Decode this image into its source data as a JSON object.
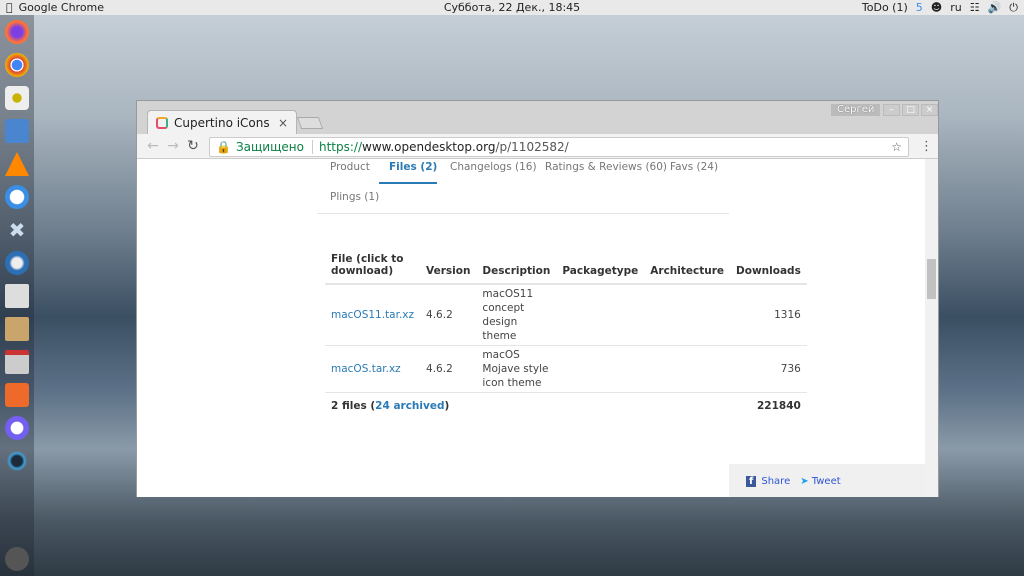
{
  "topbar": {
    "app": "Google Chrome",
    "datetime": "Суббота, 22 Дек., 18:45",
    "todo": "ToDo (1)",
    "badge": "5",
    "lang": "ru"
  },
  "dock": [
    "firefox",
    "chrome",
    "audio-player",
    "file-manager",
    "vlc",
    "simplenote",
    "system-tools",
    "thunderbird",
    "calculator",
    "package-installer",
    "archive-manager",
    "app-store",
    "viber",
    "deepin",
    "launcher"
  ],
  "browser": {
    "tab_title": "Cupertino iCons - w",
    "user": "Сергей",
    "secure_label": "Защищено",
    "url_scheme": "https://",
    "url_host": "www.opendesktop.org",
    "url_path": "/p/1102582/"
  },
  "page": {
    "tabs": [
      {
        "label": "Product"
      },
      {
        "label": "Files (2)",
        "active": true
      },
      {
        "label": "Changelogs (16)"
      },
      {
        "label": "Ratings & Reviews (60)"
      },
      {
        "label": "Favs (24)"
      },
      {
        "label": "Plings (1)"
      }
    ],
    "table": {
      "headers": [
        "File (click to download)",
        "Version",
        "Description",
        "Packagetype",
        "Architecture",
        "Downloads"
      ],
      "rows": [
        {
          "file": "macOS11.tar.xz",
          "version": "4.6.2",
          "description": "macOS11 concept design theme",
          "packagetype": "",
          "architecture": "",
          "downloads": "1316"
        },
        {
          "file": "macOS.tar.xz",
          "version": "4.6.2",
          "description": "macOS Mojave style icon theme",
          "packagetype": "",
          "architecture": "",
          "downloads": "736"
        }
      ],
      "footer_files": "2 files (",
      "footer_archived": "24 archived",
      "footer_close": ")",
      "footer_total": "221840"
    },
    "share": "Share",
    "tweet": "Tweet"
  },
  "colors": {
    "link": "#2a7ab5",
    "secure": "#0b8043"
  }
}
